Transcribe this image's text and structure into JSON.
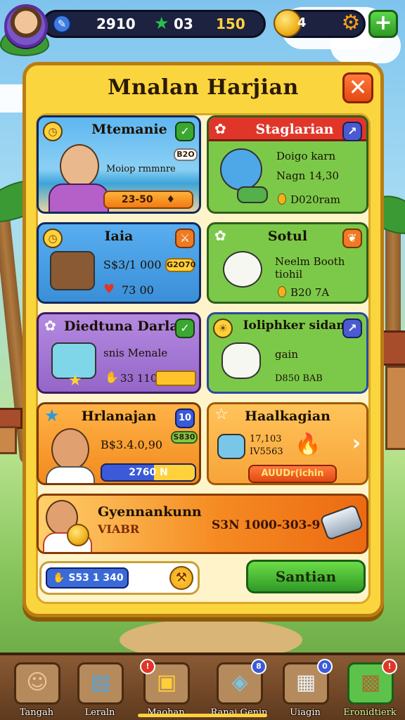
{
  "hud": {
    "gems": "2910",
    "stars": "03",
    "level": "150",
    "coins": "4",
    "plus_label": "+"
  },
  "panel": {
    "title": "Mnalan Harjian",
    "close_label": "✕"
  },
  "cards": [
    {
      "title": "Mtemanie",
      "line1": "Moiop rmmnre",
      "tag": "B2O",
      "pill": "23-50",
      "pill_icon": "♦"
    },
    {
      "title": "Staglarian",
      "line1": "Doigo karn",
      "line2": "Nagn 14,30",
      "line3": "D020ram"
    },
    {
      "title": "Iaia",
      "line1": "S$3/1 000",
      "tag": "G2O70",
      "line2": "73 00"
    },
    {
      "title": "Sotul",
      "line1": "Neelm Booth",
      "line2": "tiohil",
      "line3": "B20  7A"
    },
    {
      "title": "Diedtuna Darlag",
      "line1": "snis Menale",
      "line2": "33 110"
    },
    {
      "title": "Ioliphker sidam",
      "line1": "gain",
      "line2": "D850 BAB"
    },
    {
      "title": "Hrlanajan",
      "badge": "10",
      "line1": "B$3.4.0,90",
      "tag": "S830",
      "pill": "2760 N"
    },
    {
      "title": "Haalkagian",
      "line1": "17,103",
      "line2": "IV5563",
      "button": "AUUDr(ichin"
    },
    {
      "title": "Gyennankunn",
      "subtitle": "VIABR",
      "value": "S3N 1000-303-9"
    }
  ],
  "footer": {
    "balance": "S53   1 340",
    "action_button": "Santian"
  },
  "nav": [
    {
      "label": "Tangah",
      "badge": ""
    },
    {
      "label": "Leraln",
      "badge": ""
    },
    {
      "label": "Maohan",
      "badge": "!"
    },
    {
      "label": "Ranaj Genin",
      "badge": "8"
    },
    {
      "label": "Uiagin",
      "badge": "0"
    },
    {
      "label": "Eronidtierk",
      "badge": "!"
    }
  ],
  "colors": {
    "panel": "#fbd53d",
    "card_blue": "#4aa6e8",
    "card_green": "#7cc94a",
    "card_purple": "#a57bd6",
    "card_orange": "#f7a43a",
    "accent_orange": "#f58a22",
    "action_green": "#49c22e"
  }
}
